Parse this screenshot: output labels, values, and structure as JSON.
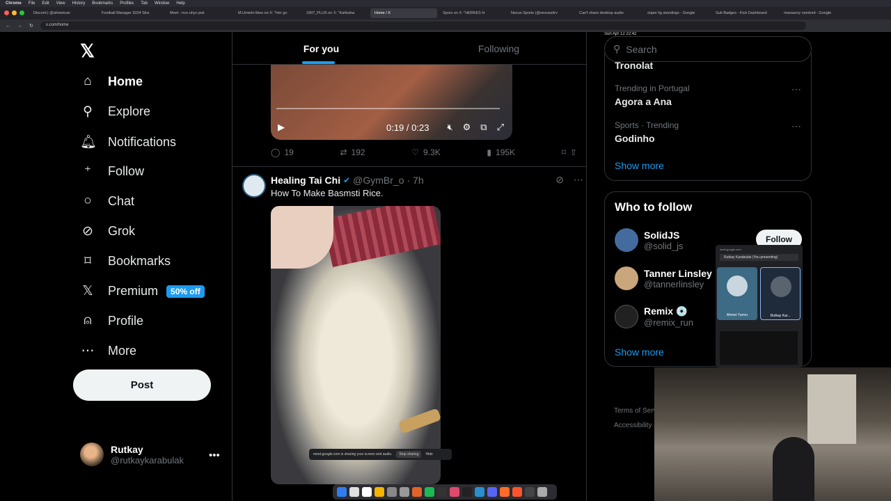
{
  "menubar": {
    "app": "Chrome",
    "menus": [
      "File",
      "Edit",
      "View",
      "History",
      "Bookmarks",
      "Profiles",
      "Tab",
      "Window",
      "Help"
    ],
    "clock": "Sun Apr 12  22:42"
  },
  "tabs": [
    "Discord | @ahmetcan",
    "Football Manager 2024 Stra",
    "Meet - nvo-uhyc-pwi",
    "M.Ummin likes on X: \"Her go",
    "1907_PLUS on X: \"Kahkaha",
    "Home / X",
    "Sporx on X: \"HERKES H",
    "Nexus Sports (@nexussitrv",
    "Can't share desktop audio",
    "süper lig standings - Google",
    "Sub Badges - Kick Dashboard",
    "manasory nsmtord - Google"
  ],
  "address": "x.com/home",
  "nav": {
    "items": [
      {
        "label": "Home",
        "icon": "home-icon"
      },
      {
        "label": "Explore",
        "icon": "search-icon"
      },
      {
        "label": "Notifications",
        "icon": "bell-icon"
      },
      {
        "label": "Follow",
        "icon": "person-add-icon"
      },
      {
        "label": "Chat",
        "icon": "chat-icon"
      },
      {
        "label": "Grok",
        "icon": "grok-icon"
      },
      {
        "label": "Bookmarks",
        "icon": "bookmark-icon"
      },
      {
        "label": "Premium",
        "icon": "x-logo-icon"
      },
      {
        "label": "Profile",
        "icon": "person-icon"
      },
      {
        "label": "More",
        "icon": "more-circle-icon"
      }
    ],
    "premium_badge": "50% off",
    "post_label": "Post"
  },
  "user": {
    "name": "Rutkay",
    "handle": "@rutkaykarabulak"
  },
  "feed_tabs": [
    "For you",
    "Following"
  ],
  "video1": {
    "time": "0:19 / 0:23"
  },
  "post1_actions": {
    "replies": "19",
    "reposts": "192",
    "likes": "9.3K",
    "views": "195K"
  },
  "post2": {
    "name": "Healing Tai Chi",
    "handle": "@GymBr_o",
    "age": "· 7h",
    "text": "How To Make Basmsti Rice."
  },
  "screenshare": {
    "text": "meet.google.com is sharing your screen and audio.",
    "stop": "Stop sharing",
    "hide": "Hide"
  },
  "search_placeholder": "Search",
  "trends": {
    "partial": "Tronolat",
    "items": [
      {
        "context": "Trending in Portugal",
        "title": "Agora a Ana"
      },
      {
        "context": "Sports · Trending",
        "title": "Godinho"
      }
    ],
    "show_more": "Show more"
  },
  "who_to_follow": {
    "title": "Who to follow",
    "accounts": [
      {
        "name": "SolidJS",
        "handle": "@solid_js",
        "color": "#446b9e"
      },
      {
        "name": "Tanner Linsley",
        "handle": "@tannerlinsley",
        "color": "#caa67c"
      },
      {
        "name": "Remix 💿",
        "handle": "@remix_run",
        "color": "#212121"
      }
    ],
    "follow_label": "Follow",
    "show_more": "Show more"
  },
  "footer": [
    "Terms of Serv",
    "Accessibility"
  ],
  "meet_panel": {
    "url": "meet.google.com",
    "presenting": "Rutkay Karabulak (You presenting)",
    "tile1": "Ahmet Yumru",
    "tile2": "Rutkay Kar..."
  },
  "colors": {
    "accent": "#1d9bf0",
    "background": "#000000",
    "border": "#2f3336"
  }
}
